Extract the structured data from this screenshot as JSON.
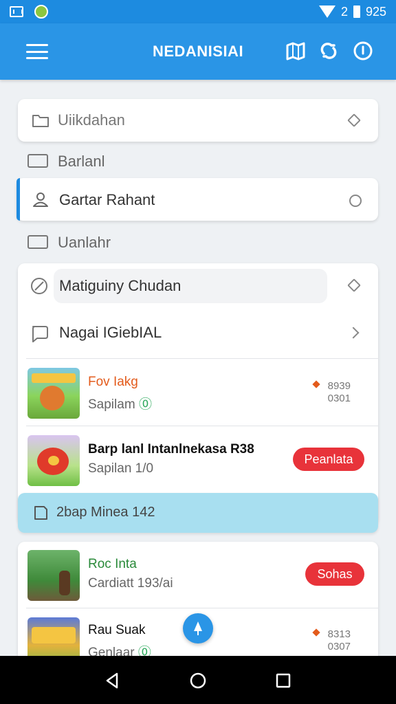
{
  "status_bar": {
    "signal_text": "2",
    "time": "925"
  },
  "app_bar": {
    "title": "NEDANISIAI"
  },
  "rows": {
    "search": {
      "label": "Uiikdahan"
    },
    "section1": {
      "label": "Barlanl"
    },
    "active_item": {
      "label": "Gartar Rahant"
    },
    "section2": {
      "label": "Uanlahr"
    },
    "pill_item": {
      "label": "Matiguiny Chudan"
    },
    "nav_item": {
      "label": "Nagai IGiebIAL"
    }
  },
  "games": [
    {
      "title": "Fov Iakg",
      "subtitle": "Sapilam",
      "meta1": "8939",
      "meta2": "0301"
    },
    {
      "title": "Barp lanl Intanlnekasa R38",
      "subtitle": "Sapilan 1/0",
      "button": "Peanlata"
    },
    {
      "title": "Roc Inta",
      "subtitle": "Cardiatt 193/ai",
      "button": "Sohas"
    },
    {
      "title": "Rau Suak",
      "subtitle": "Genlaar",
      "meta1": "8313",
      "meta2": "0307"
    }
  ],
  "highlight": {
    "label": "2bap Minea 142"
  },
  "colors": {
    "primary": "#2a95e6",
    "accent_red": "#e8333a",
    "highlight": "#a8dff0"
  }
}
